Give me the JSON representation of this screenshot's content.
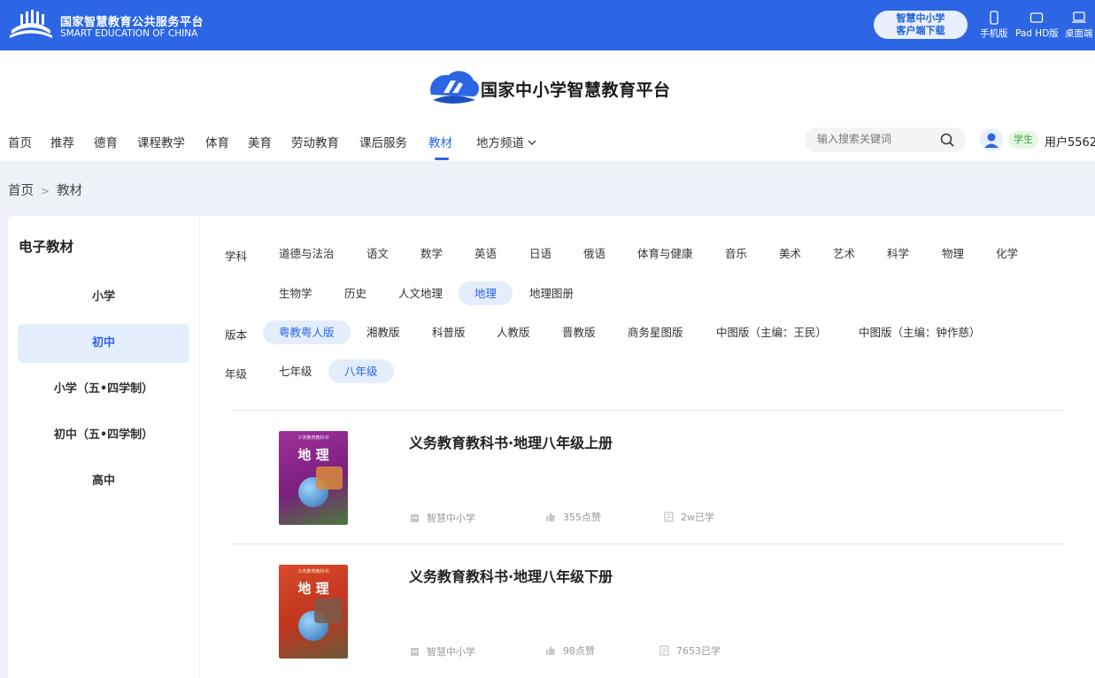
{
  "topbar": {
    "brand_cn": "国家智慧教育公共服务平台",
    "brand_en": "SMART EDUCATION OF CHINA",
    "client_line1": "智慧中小学",
    "client_line2": "客户端下载",
    "devices": [
      "手机版",
      "Pad HD版",
      "桌面端"
    ]
  },
  "header": {
    "title": "国家中小学智慧教育平台"
  },
  "nav": {
    "items": [
      "首页",
      "推荐",
      "德育",
      "课程教学",
      "体育",
      "美育",
      "劳动教育",
      "课后服务",
      "教材",
      "地方频道"
    ],
    "active": "教材"
  },
  "search": {
    "placeholder": "输入搜索关键词"
  },
  "user": {
    "role": "学生",
    "name": "用户5562"
  },
  "breadcrumb": {
    "home": "首页",
    "sep": ">",
    "current": "教材"
  },
  "sidebar": {
    "title": "电子教材",
    "items": [
      "小学",
      "初中",
      "小学（五•四学制）",
      "初中（五•四学制）",
      "高中"
    ],
    "active": "初中"
  },
  "filters": {
    "subject_label": "学科",
    "subjects": [
      "道德与法治",
      "语文",
      "数学",
      "英语",
      "日语",
      "俄语",
      "体育与健康",
      "音乐",
      "美术",
      "艺术",
      "科学",
      "物理",
      "化学",
      "生物学",
      "历史",
      "人文地理",
      "地理",
      "地理图册"
    ],
    "subject_active": "地理",
    "edition_label": "版本",
    "editions": [
      "粤教粤人版",
      "湘教版",
      "科普版",
      "人教版",
      "晋教版",
      "商务星图版",
      "中图版（主编：王民）",
      "中图版（主编：钟作慈）"
    ],
    "edition_active": "粤教粤人版",
    "grade_label": "年级",
    "grades": [
      "七年级",
      "八年级"
    ],
    "grade_active": "八年级"
  },
  "books": [
    {
      "title": "义务教育教科书·地理八年级上册",
      "cover_text": "地 理",
      "source": "智慧中小学",
      "likes": "355点赞",
      "learners": "2w已学",
      "cover_color": "#8a2a8c"
    },
    {
      "title": "义务教育教科书·地理八年级下册",
      "cover_text": "地 理",
      "source": "智慧中小学",
      "likes": "98点赞",
      "learners": "7653已学",
      "cover_color": "#c8402a"
    }
  ],
  "colors": {
    "primary": "#2c66e5",
    "active_bg": "#e4edfc",
    "page_bg": "#eef2f8"
  }
}
